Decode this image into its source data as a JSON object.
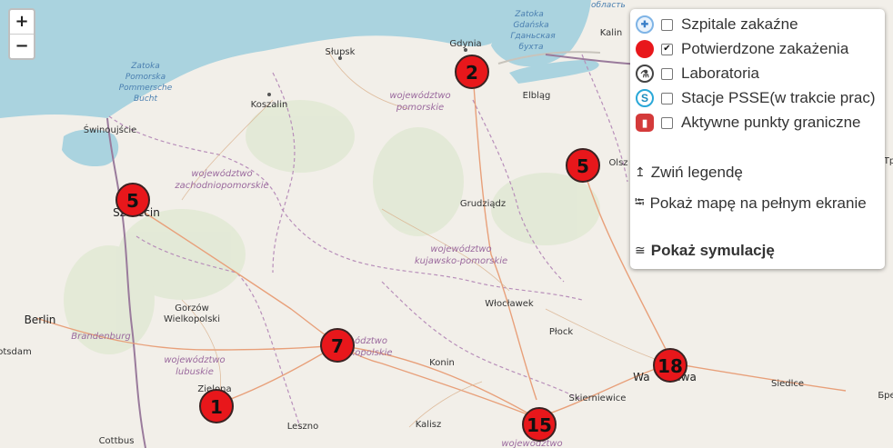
{
  "zoom": {
    "in": "+",
    "out": "−"
  },
  "legend": {
    "items": [
      {
        "label": "Szpitale zakaźne",
        "checked": false,
        "icon": "hospital-icon"
      },
      {
        "label": "Potwierdzone zakażenia",
        "checked": true,
        "icon": "red-dot-icon",
        "color": "#e8171b"
      },
      {
        "label": "Laboratoria",
        "checked": false,
        "icon": "microscope-icon"
      },
      {
        "label": "Stacje PSSE(w trakcie prac)",
        "checked": false,
        "icon": "psse-icon",
        "icon_letter": "S"
      },
      {
        "label": "Aktywne punkty graniczne",
        "checked": false,
        "icon": "border-point-icon"
      }
    ],
    "collapse": {
      "symbol": "↥",
      "label": "Zwiń legendę"
    },
    "fullscreen": {
      "symbol": "⭾",
      "label": "Pokaż mapę na pełnym ekranie"
    },
    "simulation": {
      "symbol": "≅",
      "label": "Pokaż symulację"
    }
  },
  "markers": [
    {
      "count": "2"
    },
    {
      "count": "5"
    },
    {
      "count": "5"
    },
    {
      "count": "7"
    },
    {
      "count": "18"
    },
    {
      "count": "1"
    },
    {
      "count": "15"
    }
  ],
  "places": {
    "gdynia": "Gdynia",
    "slupsk": "Słupsk",
    "koszalin": "Koszalin",
    "swinoujscie": "Świnoujście",
    "szczecin": "Szczecin",
    "elblag": "Elbląg",
    "olsztyn": "Olsz",
    "grudziadz": "Grudziądz",
    "wloclawek": "Włocławek",
    "plock": "Płock",
    "gorzow1": "Gorzów",
    "gorzow2": "Wielkopolski",
    "berlin": "Berlin",
    "potsdam": "otsdam",
    "brandenburg": "Brandenburg",
    "konin": "Konin",
    "zielona": "Zielona",
    "leszno": "Leszno",
    "kalisz": "Kalisz",
    "skierniewice": "Skierniewice",
    "warszawa": "Wa       awa",
    "siedlce": "Siedlce",
    "cottbus": "Cottbus",
    "kaliningrad": "Kalin",
    "bre": "Бре",
    "tr": "Тр"
  },
  "regions": {
    "pomorskie1": "województwo",
    "pomorskie2": "pomorskie",
    "zachodnio1": "województwo",
    "zachodnio2": "zachodniopomorskie",
    "kuj1": "województwo",
    "kuj2": "kujawsko-pomorskie",
    "lub1": "województwo",
    "lub2": "lubuskie",
    "wlkp1": "ództwo",
    "wlkp2": "kopolskie",
    "lodz": "województwo"
  },
  "waters": {
    "zalew1": "Zatoka",
    "zalew2": "Pomorska",
    "zalew3": "Pommersche",
    "zalew4": "Bucht",
    "gdansk1": "Zatoka",
    "gdansk2": "Gdańska",
    "gdansk3": "Гданьская",
    "gdansk4": "бухта",
    "oblast": "область"
  }
}
